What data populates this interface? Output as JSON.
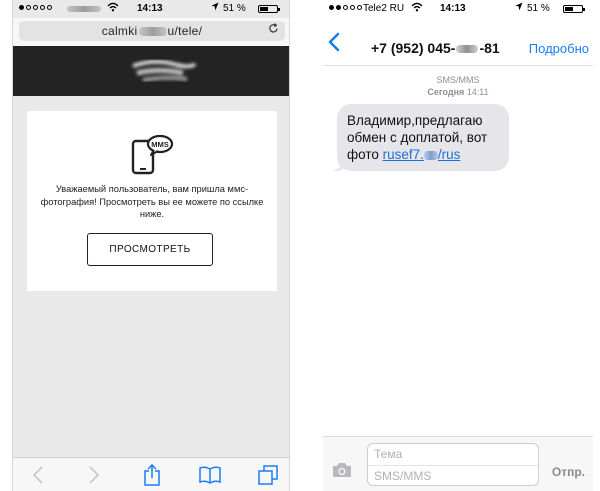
{
  "left": {
    "status": {
      "time": "14:13",
      "battery": "51 %",
      "battery_level": 0.51
    },
    "url": {
      "prefix": "calmki",
      "suffix": "u/tele/"
    },
    "card": {
      "notice": "Уважаемый пользователь, вам пришла ммс-фотография! Просмотреть вы ее можете по ссылке ниже.",
      "button": "ПРОСМОТРЕТЬ",
      "icon_label": "MMS"
    },
    "toolbar": [
      "back-icon",
      "forward-icon",
      "share-icon",
      "bookmarks-icon",
      "tabs-icon"
    ]
  },
  "right": {
    "status": {
      "carrier": "Tele2 RU",
      "time": "14:13",
      "battery": "51 %",
      "battery_level": 0.51
    },
    "nav": {
      "contact_prefix": "+7 (952) 045-",
      "contact_suffix": "-81",
      "details": "Подробно"
    },
    "meta": {
      "type": "SMS/MMS",
      "day": "Сегодня",
      "time": "14:11"
    },
    "message": {
      "text": "Владимир,предлагаю обмен с доплатой, вот фото ",
      "link_prefix": "rusef7.",
      "link_suffix": "/rus"
    },
    "compose": {
      "subject_placeholder": "Тема",
      "body_placeholder": "SMS/MMS",
      "send": "Отпр."
    }
  },
  "colors": {
    "ios_blue": "#1a7cf5",
    "bubble_gray": "#e5e5ea",
    "header_dark": "#232323",
    "page_gray": "#e9e9ea"
  }
}
